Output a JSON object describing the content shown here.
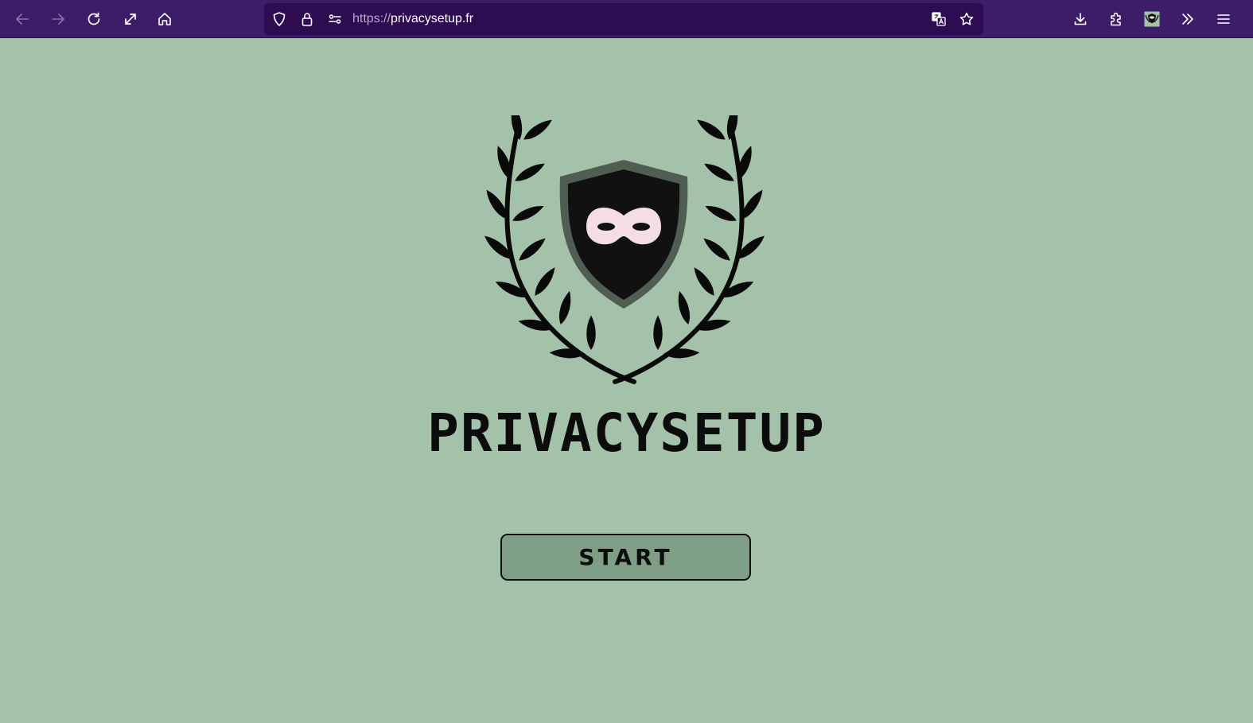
{
  "browser": {
    "url_scheme": "https://",
    "url_host": "privacysetup.fr",
    "icons": {
      "back": "back-arrow-icon",
      "forward": "forward-arrow-icon",
      "reload": "reload-icon",
      "fullscreen": "expand-icon",
      "home": "home-icon",
      "tracking_protection": "shield-icon",
      "secure": "lock-icon",
      "permissions": "site-permissions-icon",
      "translate": "translate-icon",
      "bookmark": "star-icon",
      "downloads": "download-icon",
      "extensions": "puzzle-icon",
      "extension_avatar": "privacy-extension-icon",
      "overflow": "double-chevron-icon",
      "menu": "hamburger-menu-icon"
    }
  },
  "page": {
    "brand_title": "PRIVACYSETUP",
    "start_label": "START",
    "logo_icon": "laurel-shield-mask-logo"
  },
  "colors": {
    "toolbar_bg": "#3e1d68",
    "urlbar_bg": "#2d0c52",
    "page_bg": "#a3c2a9",
    "button_bg": "#7e9e86",
    "shield_dark": "#111111",
    "shield_rim": "#4f5d53",
    "mask": "#f5dde4"
  }
}
